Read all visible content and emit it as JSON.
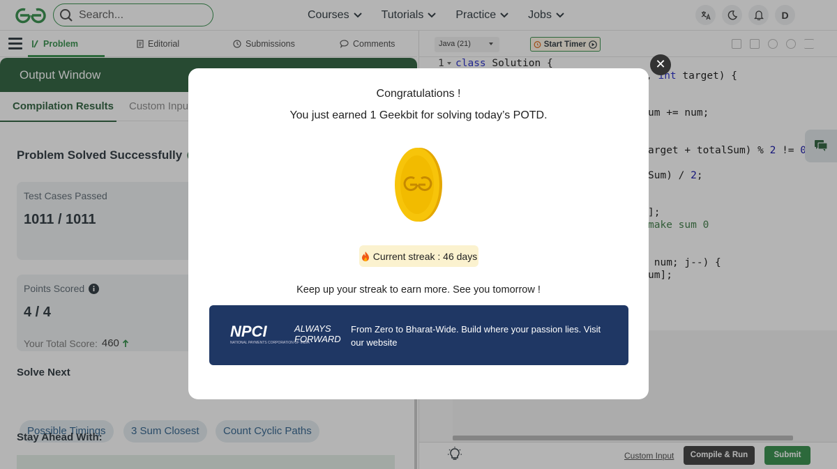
{
  "nav": {
    "search_placeholder": "Search...",
    "links": [
      "Courses",
      "Tutorials",
      "Practice",
      "Jobs"
    ],
    "avatar_letter": "D",
    "accent": "#2f8d46"
  },
  "problem_tabs": {
    "problem": "Problem",
    "editorial": "Editorial",
    "submissions": "Submissions",
    "comments": "Comments"
  },
  "output": {
    "title": "Output Window",
    "tab_compilation": "Compilation Results",
    "tab_custom": "Custom Input",
    "solved": "Problem Solved Successfully",
    "testcases_label": "Test Cases Passed",
    "testcases_value": "1011 / 1011",
    "points_label": "Points Scored",
    "points_value": "4 / 4",
    "total_label": "Your Total Score:",
    "total_value": "460",
    "solve_next": "Solve Next",
    "chips": [
      "Possible Timings",
      "3 Sum Closest",
      "Count Cyclic Paths"
    ],
    "stay_ahead": "Stay Ahead With:"
  },
  "editor": {
    "language": "Java (21)",
    "start_timer": "Start Timer",
    "custom_input": "Custom Input",
    "compile_run": "Compile & Run",
    "submit": "Submit",
    "line_no": "1",
    "code_line1_kw": "class",
    "code_line1_rest": " Solution {",
    "fragments": {
      "f1a": ", ",
      "f1b": "int",
      "f1c": " target) {",
      "f2": "um += num;",
      "f3a": "arget + totalSum) % ",
      "f3b": "2",
      "f3c": " != ",
      "f3d": "0",
      "f3e": ")",
      "f4a": "Sum) / ",
      "f4b": "2",
      "f4c": ";",
      "f5": "];",
      "f6": "make sum 0",
      "f7": " num; j--) {",
      "f8": "um];"
    }
  },
  "modal": {
    "title": "Congratulations !",
    "subtitle": "You just earned 1 Geekbit for solving today’s POTD.",
    "streak": "Current streak : 46 days",
    "keepup": "Keep up your streak to earn more. See you tomorrow !",
    "close": "✕",
    "banner_logo": "NPCI",
    "banner_logo_sub": "NATIONAL PAYMENTS CORPORATION OF INDIA",
    "banner_tag1": "ALWAYS",
    "banner_tag2": "FORWARD",
    "banner_text": "From Zero to Bharat-Wide. Build where your passion lies. Visit our website"
  }
}
